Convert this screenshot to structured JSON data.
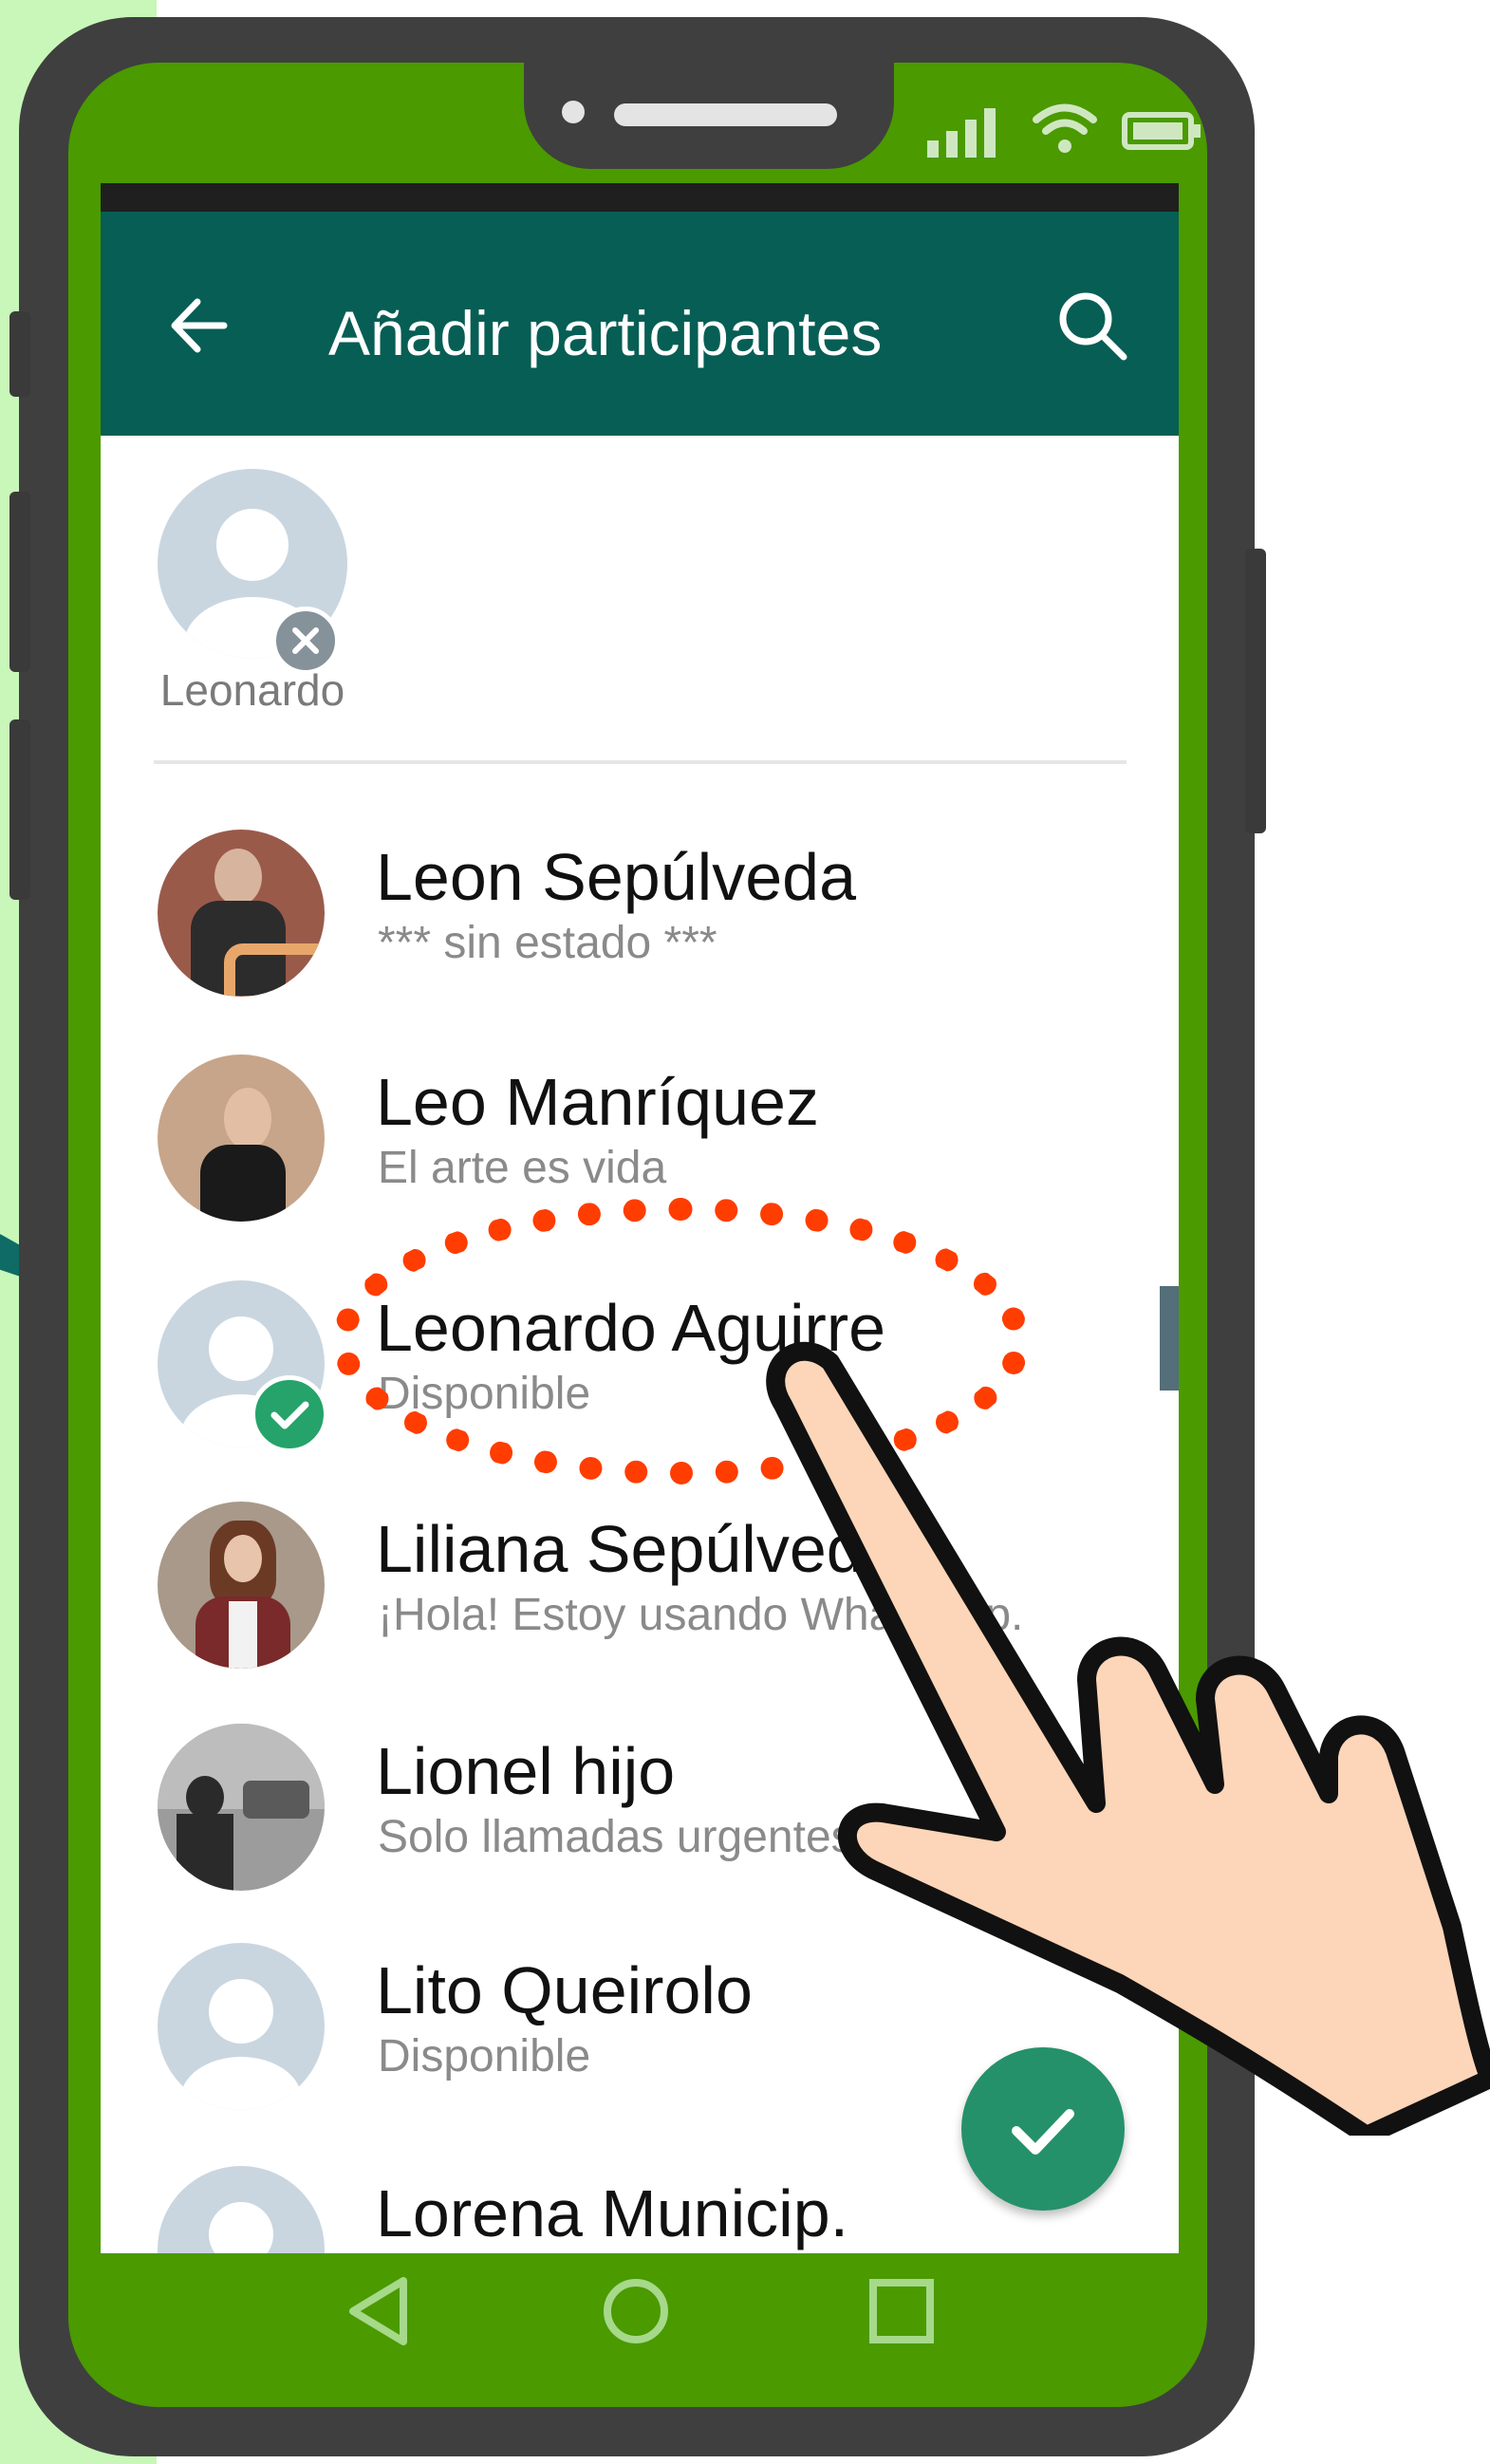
{
  "colors": {
    "header_bg": "#075e54",
    "phone_screen_green": "#4a9a00",
    "fab_green": "#25916a",
    "check_green": "#25a36a",
    "highlight_red": "#ff3d00",
    "side_bg": "#c8f7b9"
  },
  "header": {
    "back_icon": "arrow-left-icon",
    "title": "Añadir participantes",
    "search_icon": "search-icon"
  },
  "selected": [
    {
      "name": "Leonardo",
      "remove_icon": "close-icon"
    }
  ],
  "contacts": [
    {
      "name": "Leon Sepúlveda",
      "status": "*** sin estado ***",
      "avatar": "photo"
    },
    {
      "name": "Leo Manríquez",
      "status": "El arte es vida",
      "avatar": "photo"
    },
    {
      "name": "Leonardo Aguirre",
      "status": "Disponible",
      "avatar": "default",
      "selected": true
    },
    {
      "name": "Liliana Sepúlveda",
      "status": "¡Hola! Estoy usando WhatsApp.",
      "avatar": "photo"
    },
    {
      "name": "Lionel hijo",
      "status": "Solo llamadas urgentes",
      "avatar": "photo"
    },
    {
      "name": "Lito Queirolo",
      "status": "Disponible",
      "avatar": "default"
    },
    {
      "name": "Lorena Municip.",
      "status": "",
      "avatar": "default"
    }
  ],
  "fab": {
    "icon": "check-icon"
  },
  "navbar": {
    "icons": [
      "back-triangle-icon",
      "home-circle-icon",
      "recents-square-icon"
    ]
  }
}
